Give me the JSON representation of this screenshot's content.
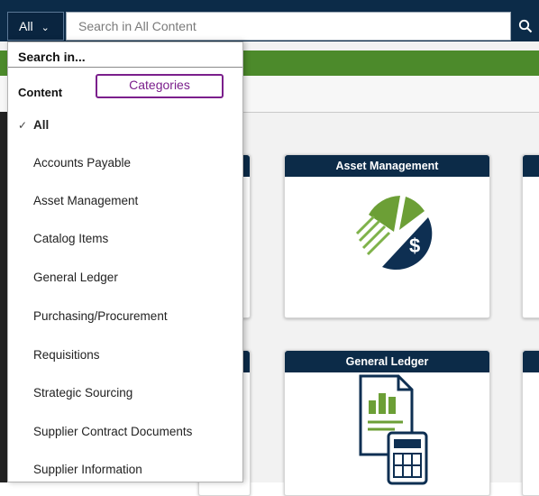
{
  "search_bar": {
    "scope_label": "All",
    "placeholder": "Search in All Content"
  },
  "dropdown": {
    "heading": "Search in...",
    "group_label": "Content",
    "callout_label": "Categories",
    "items": [
      {
        "label": "All",
        "selected": true
      },
      {
        "label": "Accounts Payable"
      },
      {
        "label": "Asset Management"
      },
      {
        "label": "Catalog Items"
      },
      {
        "label": "General Ledger"
      },
      {
        "label": "Purchasing/Procurement"
      },
      {
        "label": "Requisitions"
      },
      {
        "label": "Strategic Sourcing"
      },
      {
        "label": "Supplier Contract Documents"
      },
      {
        "label": "Supplier Information"
      }
    ]
  },
  "tiles": [
    {
      "title": "Asset Management",
      "icon": "asset-management-pie-dollar-icon"
    },
    {
      "title": "General Ledger",
      "icon": "general-ledger-document-calculator-icon"
    }
  ],
  "colors": {
    "navy": "#0c2b48",
    "green": "#4c8a2b",
    "callout": "#7b1f8c"
  }
}
